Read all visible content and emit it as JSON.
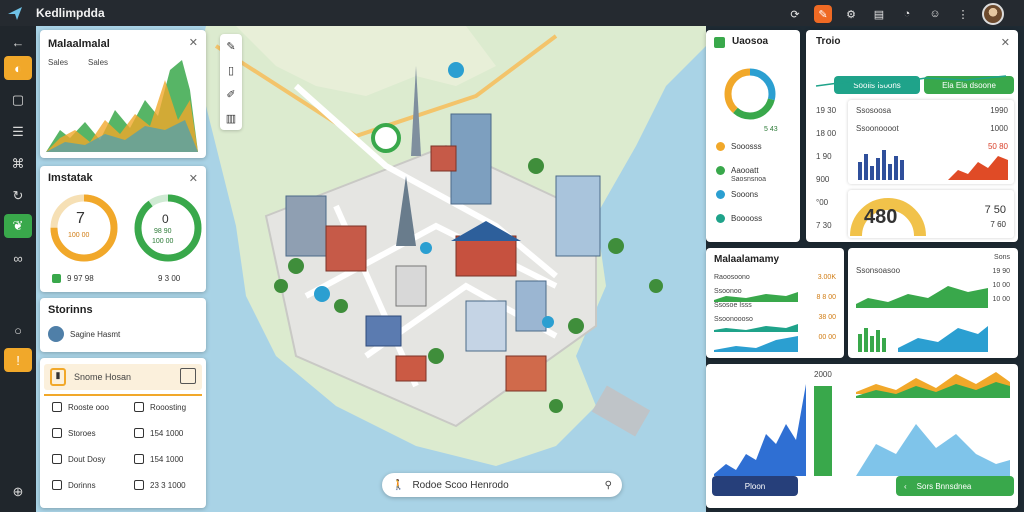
{
  "app": {
    "title": "Kedlimpdda"
  },
  "colors": {
    "accent_green": "#39a84b",
    "accent_orange": "#f1a82a",
    "accent_blue": "#2f6fd3",
    "teal": "#1fa38a"
  },
  "left_panels": {
    "chart_panel": {
      "title": "Malaalmalal",
      "legend_a": "Sales",
      "legend_b": "Sales"
    },
    "gauge_panel": {
      "title": "Imstatak",
      "gauge1": {
        "value": "7",
        "label": "100 00",
        "fill": 0.75
      },
      "gauge2": {
        "value": "0",
        "label1": "98 90",
        "label2": "100 00",
        "fill": 0.9
      },
      "foot1": "9 97 98",
      "foot2": "9 3 00"
    },
    "stations_panel": {
      "title": "Storinns",
      "item": "Sagine Hasmt"
    },
    "list_panel": {
      "header": "Snome Hosan",
      "items": [
        {
          "icon": "doc-icon",
          "label": "Rooste ooo"
        },
        {
          "icon": "doc-icon",
          "label": "Rooosting"
        },
        {
          "icon": "grid-icon",
          "label": "Storoes"
        },
        {
          "icon": "grid-icon",
          "label": "154 1000"
        },
        {
          "icon": "grid-icon",
          "label": "Dout Dosy"
        },
        {
          "icon": "grid-icon",
          "label": "154 1000"
        },
        {
          "icon": "car-icon",
          "label": "Dorinns"
        },
        {
          "icon": "pen-icon",
          "label": "23 3 1000"
        }
      ]
    }
  },
  "map": {
    "search_value": "Rodoe Scoo Henrodo"
  },
  "right_panels": {
    "donut_panel": {
      "title": "Uaosoa",
      "center_label": "5 43",
      "rows": [
        {
          "color": "#f1a82a",
          "label": "Sooosss"
        },
        {
          "color": "#39a84b",
          "label": "Aaooatt",
          "sub": "Saosnsnoa"
        },
        {
          "color": "#2b9fd1",
          "label": "Sooons"
        },
        {
          "color": "#1fa38a",
          "label": "Booooss"
        }
      ]
    },
    "trend_panel": {
      "title": "Troio",
      "btn_a": "Sooiis Isoons",
      "btn_b": "Ela Ela dsoone",
      "axis": [
        "19 30",
        "18 00",
        "1 90",
        "900",
        "°00",
        "7 30"
      ],
      "bar_title": "Ssosoosa",
      "bar_sub": "Ssoonoooot",
      "bar_val1": "1990",
      "bar_val2": "1000",
      "bar_val3": "50 80",
      "gauge_value": "480",
      "gauge_r1": "7 50",
      "gauge_r2": "7 60"
    },
    "mid_panel": {
      "title": "Malaalamamy",
      "rows": [
        "Raoosoono",
        "Ssoonoo",
        "Ssosoe Isss",
        "Ssoonoooso"
      ],
      "values": [
        "3.00K",
        "8 8 00",
        "38 00",
        "00 00"
      ],
      "right_title": "Ssonsoasoo",
      "right_values": [
        "Sons",
        "19 90",
        "10 00",
        "10 00"
      ]
    },
    "bottom_panel": {
      "big_value": "2000",
      "btn_left": "Ploon",
      "btn_right": "Sors Bnnsdnea"
    }
  }
}
